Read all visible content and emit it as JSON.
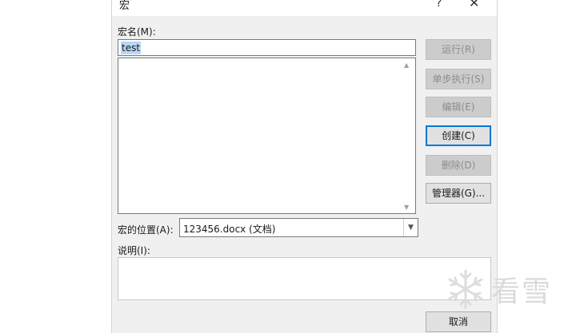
{
  "dialog": {
    "title": "宏",
    "help_label": "?",
    "close_label": "✕"
  },
  "macro_name": {
    "label": "宏名(M):",
    "value": "test"
  },
  "macro_list": {
    "items": []
  },
  "location": {
    "label": "宏的位置(A):",
    "value": "123456.docx (文档)"
  },
  "description": {
    "label": "说明(I):",
    "value": ""
  },
  "buttons": {
    "run": "运行(R)",
    "step_into": "单步执行(S)",
    "edit": "编辑(E)",
    "create": "创建(C)",
    "delete": "删除(D)",
    "organizer": "管理器(G)...",
    "cancel": "取消"
  },
  "watermark": {
    "text": "看雪"
  }
}
